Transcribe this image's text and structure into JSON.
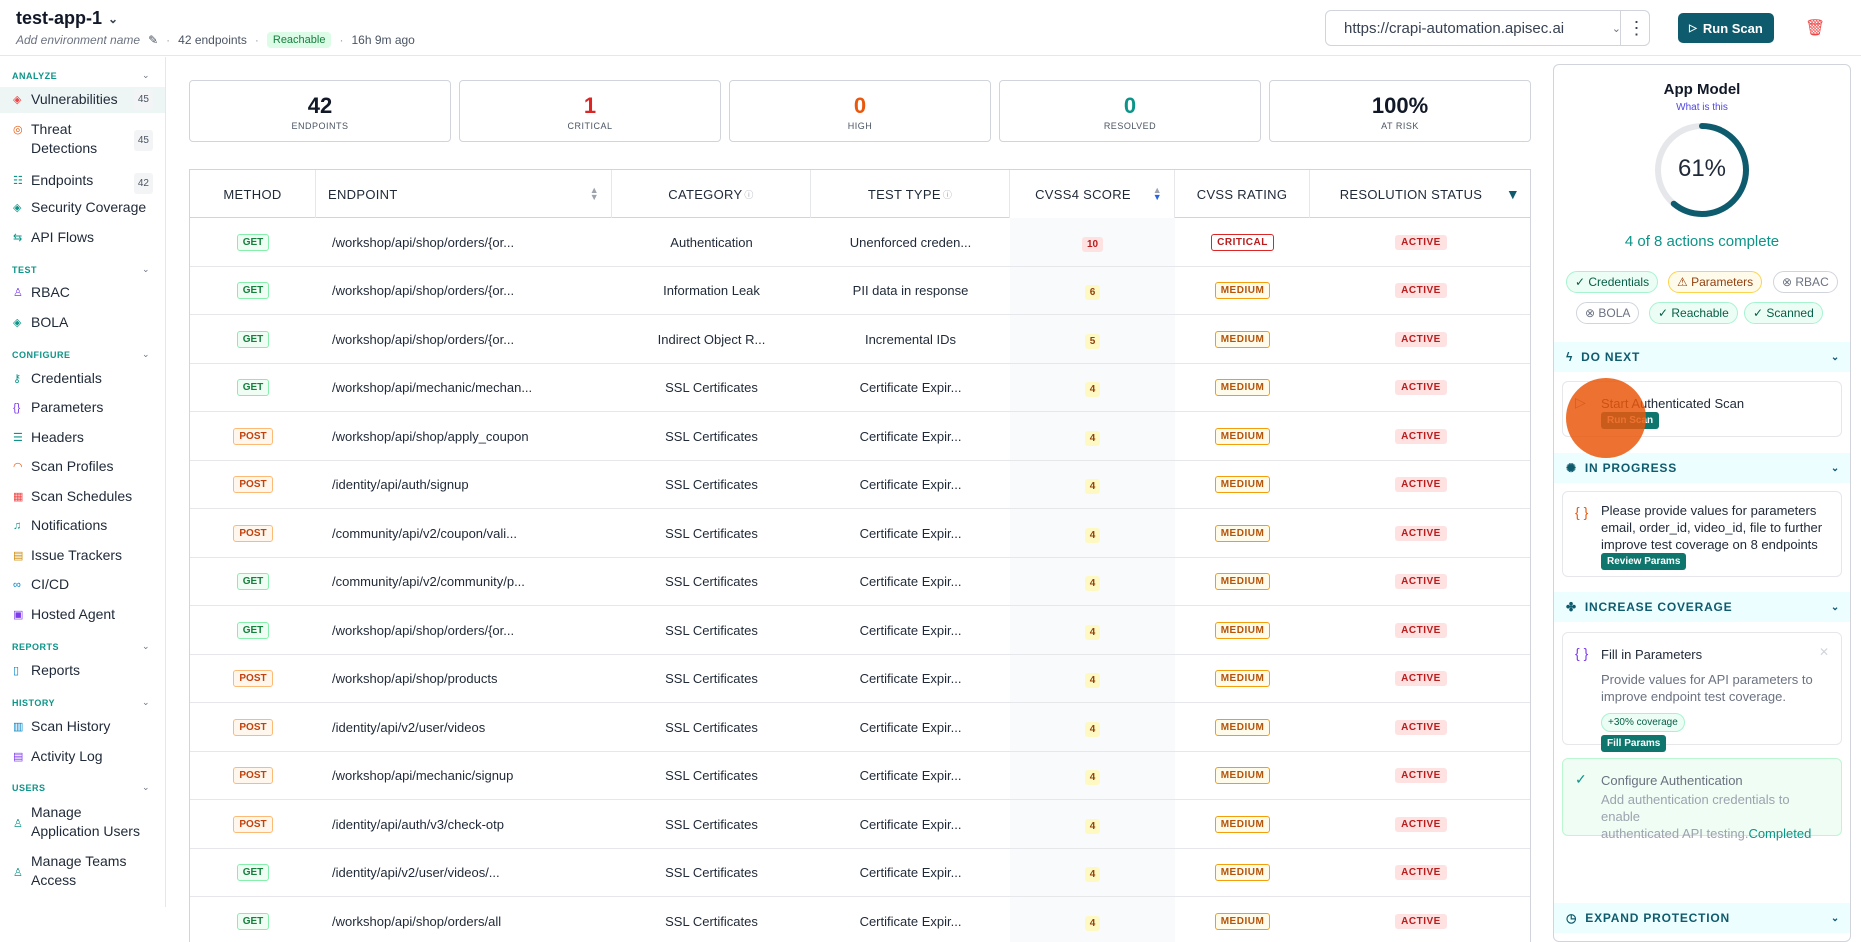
{
  "header": {
    "app_name": "test-app-1",
    "env_placeholder": "Add environment name",
    "endpoints_count": "42 endpoints",
    "reachable": "Reachable",
    "last_scan": "16h 9m ago",
    "url": "https://crapi-automation.apisec.ai",
    "run_scan": "Run Scan"
  },
  "sidebar": {
    "analyze_label": "ANALYZE",
    "vulnerabilities": "Vulnerabilities",
    "vulnerabilities_count": "45",
    "threat_detections_1": "Threat",
    "threat_detections_2": "Detections",
    "threat_count": "45",
    "endpoints": "Endpoints",
    "endpoints_count": "42",
    "security_coverage": "Security Coverage",
    "api_flows": "API Flows",
    "test_label": "TEST",
    "rbac": "RBAC",
    "bola": "BOLA",
    "configure_label": "CONFIGURE",
    "credentials": "Credentials",
    "parameters": "Parameters",
    "headers": "Headers",
    "scan_profiles": "Scan Profiles",
    "scan_schedules": "Scan Schedules",
    "notifications": "Notifications",
    "issue_trackers": "Issue Trackers",
    "cicd": "CI/CD",
    "hosted_agent": "Hosted Agent",
    "reports_label": "REPORTS",
    "reports": "Reports",
    "history_label": "HISTORY",
    "scan_history": "Scan History",
    "activity_log": "Activity Log",
    "users_label": "USERS",
    "manage_app_users_1": "Manage",
    "manage_app_users_2": "Application Users",
    "manage_teams_1": "Manage Teams",
    "manage_teams_2": "Access"
  },
  "stats": {
    "endpoints": {
      "value": "42",
      "label": "ENDPOINTS"
    },
    "critical": {
      "value": "1",
      "label": "CRITICAL"
    },
    "high": {
      "value": "0",
      "label": "HIGH"
    },
    "resolved": {
      "value": "0",
      "label": "RESOLVED"
    },
    "at_risk": {
      "value": "100%",
      "label": "AT RISK"
    }
  },
  "table": {
    "headers": {
      "method": "METHOD",
      "endpoint": "ENDPOINT",
      "category": "CATEGORY",
      "test_type": "TEST TYPE",
      "cvss4": "CVSS4 SCORE",
      "rating": "CVSS RATING",
      "status": "RESOLUTION STATUS"
    },
    "rows": [
      {
        "method": "GET",
        "endpoint": "/workshop/api/shop/orders/{or...",
        "category": "Authentication",
        "test_type": "Unenforced creden...",
        "score": "10",
        "rating": "CRITICAL",
        "status": "ACTIVE"
      },
      {
        "method": "GET",
        "endpoint": "/workshop/api/shop/orders/{or...",
        "category": "Information Leak",
        "test_type": "PII data in response",
        "score": "6",
        "rating": "MEDIUM",
        "status": "ACTIVE"
      },
      {
        "method": "GET",
        "endpoint": "/workshop/api/shop/orders/{or...",
        "category": "Indirect Object R...",
        "test_type": "Incremental IDs",
        "score": "5",
        "rating": "MEDIUM",
        "status": "ACTIVE"
      },
      {
        "method": "GET",
        "endpoint": "/workshop/api/mechanic/mechan...",
        "category": "SSL Certificates",
        "test_type": "Certificate Expir...",
        "score": "4",
        "rating": "MEDIUM",
        "status": "ACTIVE"
      },
      {
        "method": "POST",
        "endpoint": "/workshop/api/shop/apply_coupon",
        "category": "SSL Certificates",
        "test_type": "Certificate Expir...",
        "score": "4",
        "rating": "MEDIUM",
        "status": "ACTIVE"
      },
      {
        "method": "POST",
        "endpoint": "/identity/api/auth/signup",
        "category": "SSL Certificates",
        "test_type": "Certificate Expir...",
        "score": "4",
        "rating": "MEDIUM",
        "status": "ACTIVE"
      },
      {
        "method": "POST",
        "endpoint": "/community/api/v2/coupon/vali...",
        "category": "SSL Certificates",
        "test_type": "Certificate Expir...",
        "score": "4",
        "rating": "MEDIUM",
        "status": "ACTIVE"
      },
      {
        "method": "GET",
        "endpoint": "/community/api/v2/community/p...",
        "category": "SSL Certificates",
        "test_type": "Certificate Expir...",
        "score": "4",
        "rating": "MEDIUM",
        "status": "ACTIVE"
      },
      {
        "method": "GET",
        "endpoint": "/workshop/api/shop/orders/{or...",
        "category": "SSL Certificates",
        "test_type": "Certificate Expir...",
        "score": "4",
        "rating": "MEDIUM",
        "status": "ACTIVE"
      },
      {
        "method": "POST",
        "endpoint": "/workshop/api/shop/products",
        "category": "SSL Certificates",
        "test_type": "Certificate Expir...",
        "score": "4",
        "rating": "MEDIUM",
        "status": "ACTIVE"
      },
      {
        "method": "POST",
        "endpoint": "/identity/api/v2/user/videos",
        "category": "SSL Certificates",
        "test_type": "Certificate Expir...",
        "score": "4",
        "rating": "MEDIUM",
        "status": "ACTIVE"
      },
      {
        "method": "POST",
        "endpoint": "/workshop/api/mechanic/signup",
        "category": "SSL Certificates",
        "test_type": "Certificate Expir...",
        "score": "4",
        "rating": "MEDIUM",
        "status": "ACTIVE"
      },
      {
        "method": "POST",
        "endpoint": "/identity/api/auth/v3/check-otp",
        "category": "SSL Certificates",
        "test_type": "Certificate Expir...",
        "score": "4",
        "rating": "MEDIUM",
        "status": "ACTIVE"
      },
      {
        "method": "GET",
        "endpoint": "/identity/api/v2/user/videos/...",
        "category": "SSL Certificates",
        "test_type": "Certificate Expir...",
        "score": "4",
        "rating": "MEDIUM",
        "status": "ACTIVE"
      },
      {
        "method": "GET",
        "endpoint": "/workshop/api/shop/orders/all",
        "category": "SSL Certificates",
        "test_type": "Certificate Expir...",
        "score": "4",
        "rating": "MEDIUM",
        "status": "ACTIVE"
      }
    ]
  },
  "app_model": {
    "title": "App Model",
    "what_link": "What is this",
    "progress": 0.61,
    "progress_label": "61%",
    "actions_done": "4 of 8 actions complete",
    "chips": {
      "credentials": "Credentials",
      "parameters": "Parameters",
      "rbac": "RBAC",
      "bola": "BOLA",
      "reachable": "Reachable",
      "scanned": "Scanned"
    },
    "do_next": {
      "heading": "DO NEXT",
      "card_title": "Start Authenticated Scan",
      "button": "Run Scan"
    },
    "in_progress": {
      "heading": "IN PROGRESS",
      "line1": "Please provide values for parameters",
      "line2": "email, order_id, video_id, file to further",
      "line3": "improve test coverage on 8 endpoints",
      "button": "Review Params"
    },
    "increase_coverage": {
      "heading": "INCREASE COVERAGE",
      "card_title": "Fill in Parameters",
      "line1": "Provide values for API parameters to",
      "line2": "improve endpoint test coverage.",
      "chip": "+30% coverage",
      "button": "Fill Params"
    },
    "configure_auth": {
      "title": "Configure Authentication",
      "line1": "Add authentication credentials to enable",
      "line2": "authenticated API testing.",
      "completed": "Completed"
    },
    "expand_protection": {
      "heading": "EXPAND PROTECTION"
    }
  }
}
